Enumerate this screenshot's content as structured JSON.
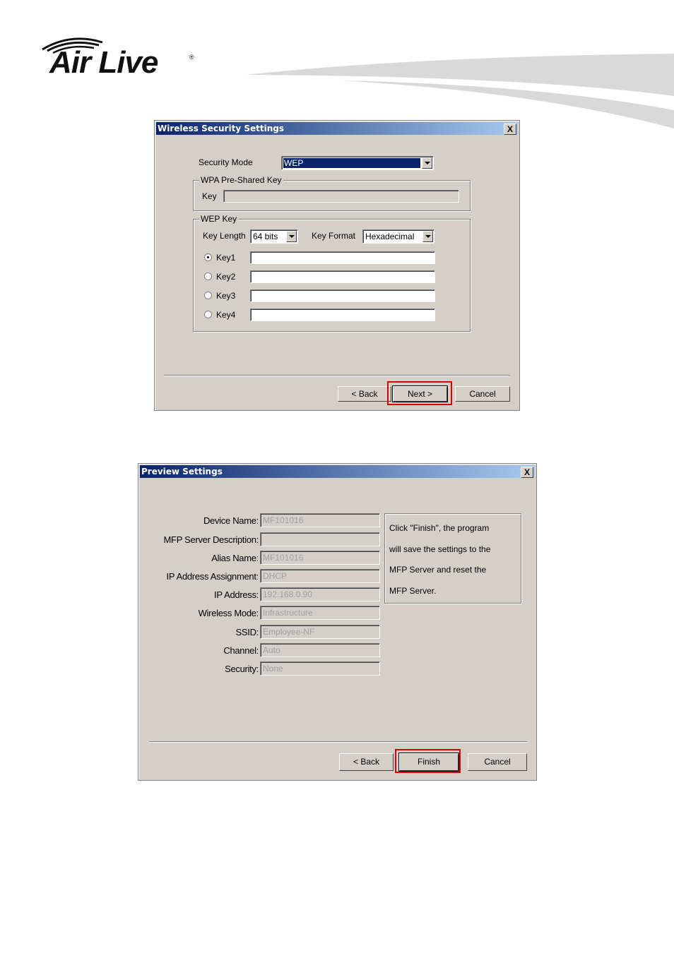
{
  "brand": {
    "logo_text": "Air Live",
    "registered": "®",
    "swoosh_color": "#d9d9d9"
  },
  "colors": {
    "dialog_bg": "#d4d0c8",
    "title_start": "#0a246a",
    "title_end": "#a6caf0",
    "highlight": "#e00000"
  },
  "wireless_dialog": {
    "title": "Wireless Security Settings",
    "close": "X",
    "security_mode_label": "Security Mode",
    "security_mode_value": "WEP",
    "wpa_group": "WPA Pre-Shared Key",
    "wpa_key_label": "Key",
    "wpa_key_value": "",
    "wep_group": "WEP Key",
    "key_length_label": "Key Length",
    "key_length_value": "64 bits",
    "key_format_label": "Key Format",
    "key_format_value": "Hexadecimal",
    "keys": [
      {
        "label": "Key1",
        "selected": true,
        "value": ""
      },
      {
        "label": "Key2",
        "selected": false,
        "value": ""
      },
      {
        "label": "Key3",
        "selected": false,
        "value": ""
      },
      {
        "label": "Key4",
        "selected": false,
        "value": ""
      }
    ],
    "back": "< Back",
    "next": "Next >",
    "cancel": "Cancel"
  },
  "preview_dialog": {
    "title": "Preview Settings",
    "close": "X",
    "fields": [
      {
        "label": "Device Name:",
        "value": "MF101016"
      },
      {
        "label": "MFP Server Description:",
        "value": ""
      },
      {
        "label": "Alias Name:",
        "value": "MF101016"
      },
      {
        "label": "IP Address Assignment:",
        "value": "DHCP"
      },
      {
        "label": "IP Address:",
        "value": "192.168.0.90"
      },
      {
        "label": "Wireless Mode:",
        "value": "Infrastructure"
      },
      {
        "label": "SSID:",
        "value": "Employee-NF"
      },
      {
        "label": "Channel:",
        "value": "Auto"
      },
      {
        "label": "Security:",
        "value": "None"
      }
    ],
    "info_lines": [
      "Click \"Finish\", the program",
      "will save the settings to the",
      "MFP Server and reset the",
      "MFP Server."
    ],
    "back": "< Back",
    "finish": "Finish",
    "cancel": "Cancel"
  }
}
